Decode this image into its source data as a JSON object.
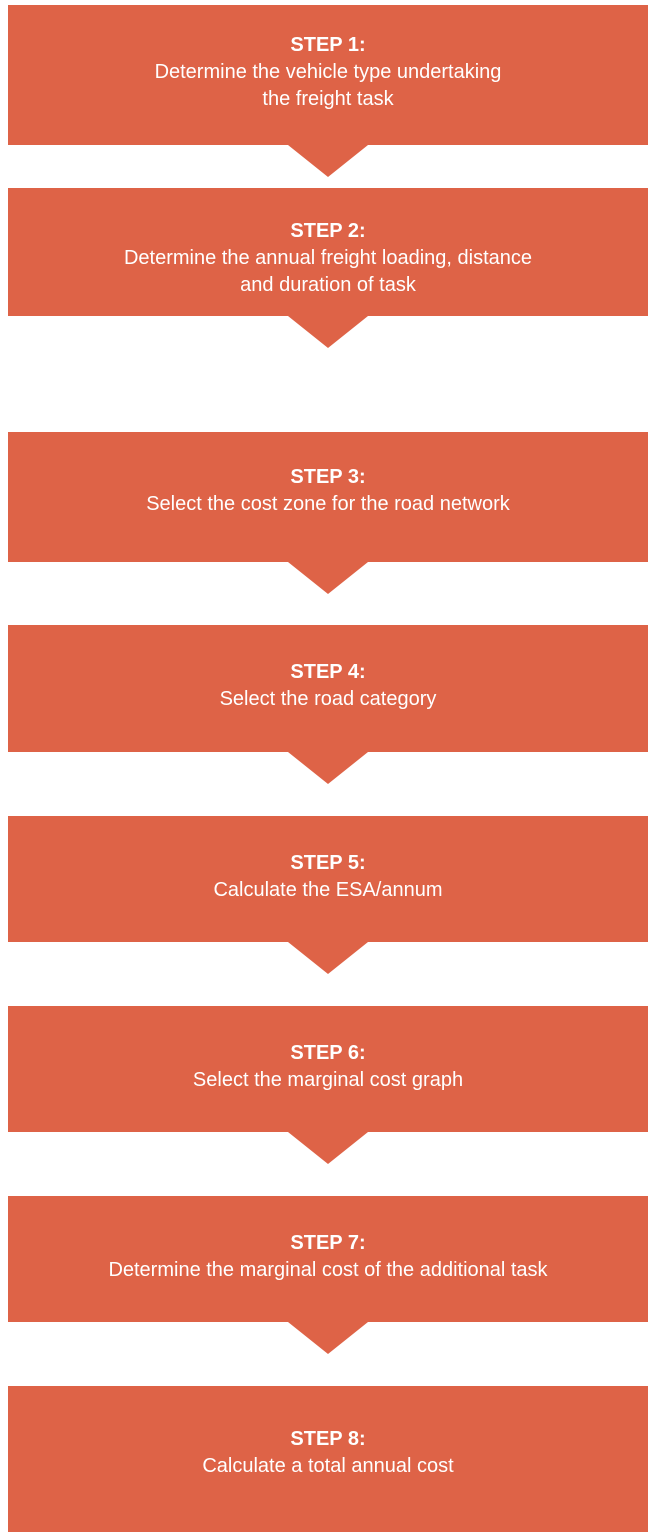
{
  "colors": {
    "box_fill": "#de6347",
    "text": "#ffffff",
    "background": "#ffffff"
  },
  "steps": [
    {
      "title": "STEP 1:",
      "desc_line1": "Determine the vehicle type undertaking",
      "desc_line2": "the freight task"
    },
    {
      "title": "STEP 2:",
      "desc_line1": "Determine the annual freight loading, distance",
      "desc_line2": "and duration of task"
    },
    {
      "title": "STEP 3:",
      "desc_line1": "Select the cost zone for the road network",
      "desc_line2": ""
    },
    {
      "title": "STEP 4:",
      "desc_line1": "Select the road category",
      "desc_line2": ""
    },
    {
      "title": "STEP 5:",
      "desc_line1": "Calculate the ESA/annum",
      "desc_line2": ""
    },
    {
      "title": "STEP 6:",
      "desc_line1": "Select the marginal cost graph",
      "desc_line2": ""
    },
    {
      "title": "STEP 7:",
      "desc_line1": "Determine the marginal cost of the additional task",
      "desc_line2": ""
    },
    {
      "title": "STEP 8:",
      "desc_line1": "Calculate a total annual cost",
      "desc_line2": ""
    }
  ]
}
